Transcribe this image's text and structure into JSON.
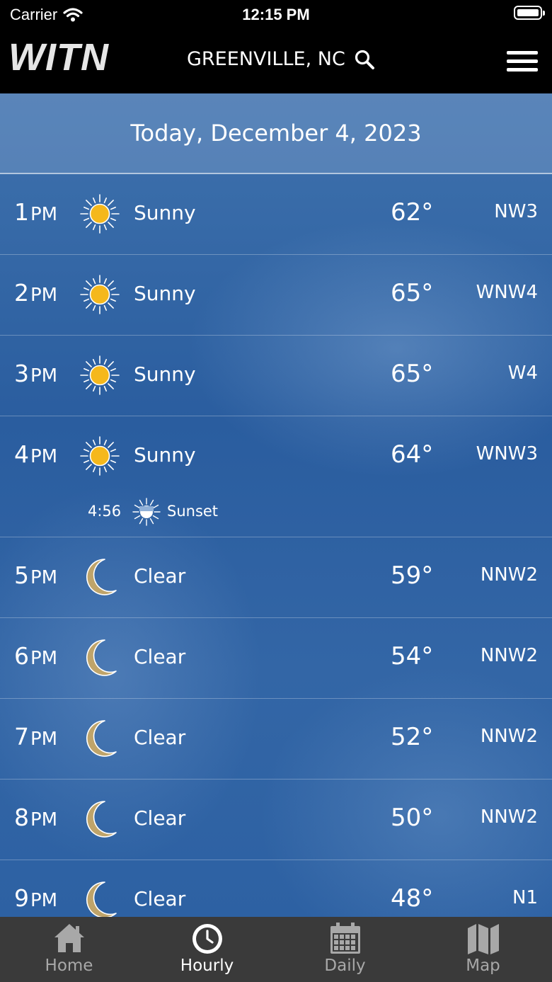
{
  "status_bar": {
    "carrier": "Carrier",
    "time": "12:15 PM"
  },
  "header": {
    "logo": "WITN",
    "location": "GREENVILLE, NC"
  },
  "date_header": "Today, December 4, 2023",
  "hours": [
    {
      "hour": "1",
      "ampm": "PM",
      "icon": "sun-icon",
      "condition": "Sunny",
      "temp": "62°",
      "wind": "NW3"
    },
    {
      "hour": "2",
      "ampm": "PM",
      "icon": "sun-icon",
      "condition": "Sunny",
      "temp": "65°",
      "wind": "WNW4"
    },
    {
      "hour": "3",
      "ampm": "PM",
      "icon": "sun-icon",
      "condition": "Sunny",
      "temp": "65°",
      "wind": "W4"
    },
    {
      "hour": "4",
      "ampm": "PM",
      "icon": "sun-icon",
      "condition": "Sunny",
      "temp": "64°",
      "wind": "WNW3",
      "event": {
        "time": "4:56",
        "label": "Sunset",
        "icon": "sunset-icon"
      }
    },
    {
      "hour": "5",
      "ampm": "PM",
      "icon": "moon-icon",
      "condition": "Clear",
      "temp": "59°",
      "wind": "NNW2"
    },
    {
      "hour": "6",
      "ampm": "PM",
      "icon": "moon-icon",
      "condition": "Clear",
      "temp": "54°",
      "wind": "NNW2"
    },
    {
      "hour": "7",
      "ampm": "PM",
      "icon": "moon-icon",
      "condition": "Clear",
      "temp": "52°",
      "wind": "NNW2"
    },
    {
      "hour": "8",
      "ampm": "PM",
      "icon": "moon-icon",
      "condition": "Clear",
      "temp": "50°",
      "wind": "NNW2"
    },
    {
      "hour": "9",
      "ampm": "PM",
      "icon": "moon-icon",
      "condition": "Clear",
      "temp": "48°",
      "wind": "N1"
    }
  ],
  "tabs": [
    {
      "label": "Home",
      "icon": "home-icon",
      "active": false
    },
    {
      "label": "Hourly",
      "icon": "clock-icon",
      "active": true
    },
    {
      "label": "Daily",
      "icon": "calendar-icon",
      "active": false
    },
    {
      "label": "Map",
      "icon": "map-icon",
      "active": false
    }
  ],
  "colors": {
    "sun": "#f5b81c",
    "moon": "#bfa46a",
    "header_bg": "#000000",
    "tabbar_bg": "#3a3a3a"
  }
}
